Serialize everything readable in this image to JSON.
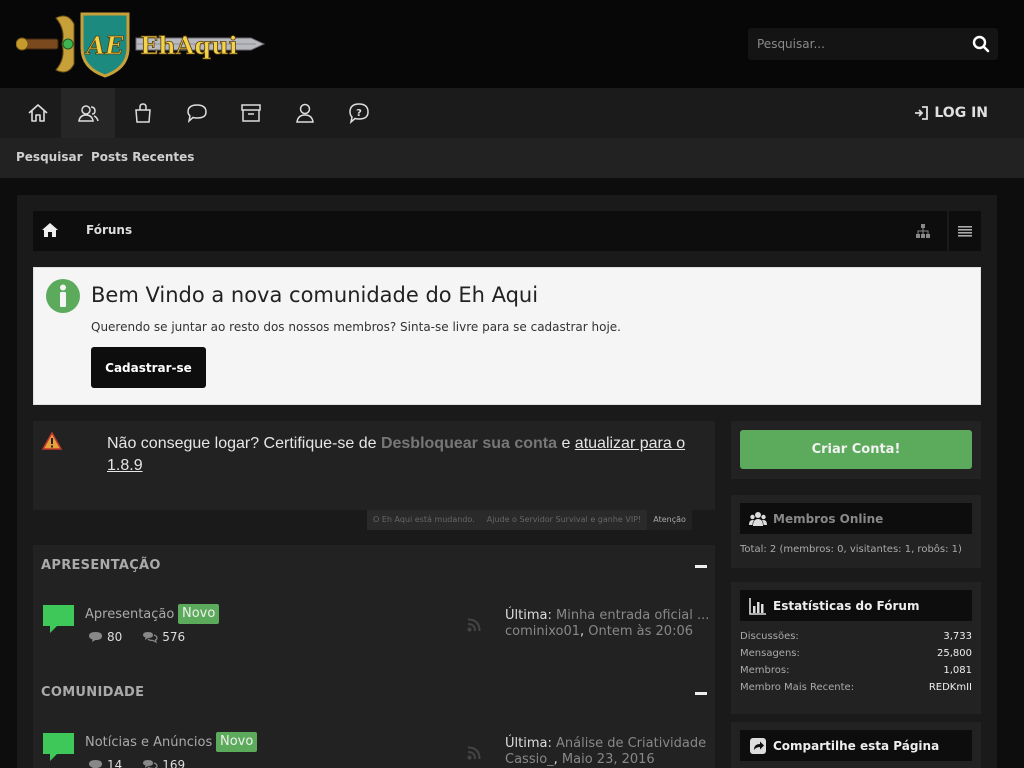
{
  "header": {
    "logo_text": "AE EhAqui",
    "search_placeholder": "Pesquisar..."
  },
  "nav": {
    "tabs": [
      {
        "icon": "home-icon"
      },
      {
        "icon": "users-icon"
      },
      {
        "icon": "shopping-bag-icon"
      },
      {
        "icon": "chat-bubble-icon"
      },
      {
        "icon": "archive-icon"
      },
      {
        "icon": "members-icon"
      },
      {
        "icon": "help-icon"
      }
    ],
    "login_label": "LOG IN"
  },
  "subnav": {
    "search": "Pesquisar",
    "recent_posts": "Posts Recentes"
  },
  "breadcrumb": {
    "forums": "Fóruns"
  },
  "welcome": {
    "title": "Bem Vindo a nova comunidade do Eh Aqui",
    "text": "Querendo se juntar ao resto dos nossos membros? Sinta-se livre para se cadastrar hoje.",
    "register_label": "Cadastrar-se"
  },
  "notice": {
    "text_before": "Não consegue logar? Certifique-se de ",
    "unlock_text": "Desbloquear sua conta",
    "text_middle": " e ",
    "update_text": "atualizar para o 1.8.9",
    "tabs": [
      "O Eh Aqui está mudando.",
      "Ajude o Servidor Survival e ganhe VIP!",
      "Atenção"
    ]
  },
  "categories": [
    {
      "title": "APRESENTAÇÃO",
      "forum": {
        "name": "Apresentação",
        "badge": "Novo",
        "threads": "80",
        "posts": "576",
        "last_label": "Última:",
        "last_title": "Minha entrada oficial ...",
        "last_user": "cominixo01",
        "last_date": "Ontem às 20:06"
      }
    },
    {
      "title": "COMUNIDADE",
      "forum": {
        "name": "Notícias e Anúncios",
        "badge": "Novo",
        "threads": "14",
        "posts": "169",
        "last_label": "Última:",
        "last_title": "Análise de Criatividade",
        "last_user": "Cassio_",
        "last_date": "Maio 23, 2016"
      }
    }
  ],
  "sidebar": {
    "create_account": "Criar Conta!",
    "online": {
      "title": "Membros Online",
      "total": "Total: 2 (membros: 0, visitantes: 1, robôs: 1)"
    },
    "stats": {
      "title": "Estatísticas do Fórum",
      "rows": [
        {
          "label": "Discussões:",
          "value": "3,733"
        },
        {
          "label": "Mensagens:",
          "value": "25,800"
        },
        {
          "label": "Membros:",
          "value": "1,081"
        },
        {
          "label": "Membro Mais Recente:",
          "value": "REDKmII"
        }
      ]
    },
    "share": {
      "title": "Compartilhe esta Página"
    }
  },
  "colors": {
    "accent_green": "#5cab5c",
    "background": "#0d0d0d",
    "panel": "#222222"
  }
}
